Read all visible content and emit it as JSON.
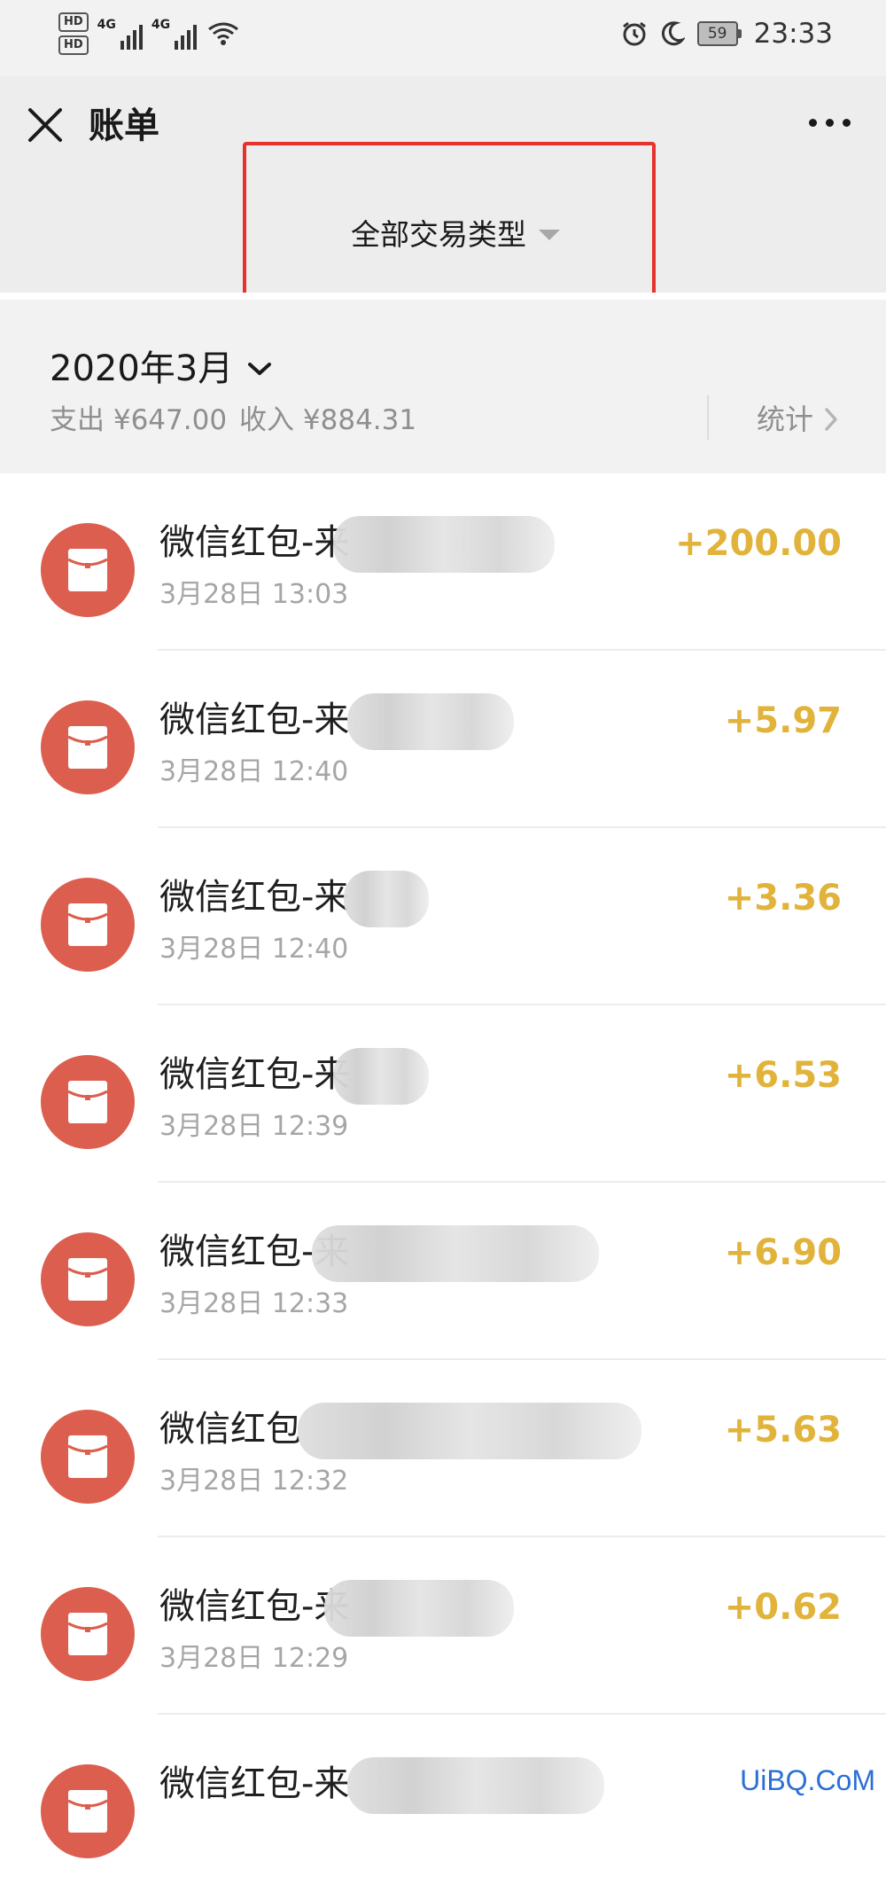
{
  "status_bar": {
    "hd1": "HD",
    "hd2": "HD",
    "sim1_tag": "4G",
    "sim2_tag": "4G",
    "battery": "59",
    "time": "23:33"
  },
  "nav": {
    "title": "账单",
    "close_icon": "close-icon",
    "more_icon": "more-icon"
  },
  "filter": {
    "label": "全部交易类型",
    "highlight_color": "#e5322d"
  },
  "month_header": {
    "month": "2020年3月",
    "expense": "支出 ¥647.00",
    "income": "收入 ¥884.31",
    "stats_label": "统计"
  },
  "transactions": [
    {
      "title": "微信红包-来",
      "time": "3月28日 13:03",
      "amount": "+200.00"
    },
    {
      "title": "微信红包-来",
      "time": "3月28日 12:40",
      "amount": "+5.97"
    },
    {
      "title": "微信红包-来",
      "time": "3月28日 12:40",
      "amount": "+3.36"
    },
    {
      "title": "微信红包-来",
      "time": "3月28日 12:39",
      "amount": "+6.53"
    },
    {
      "title": "微信红包-来",
      "time": "3月28日 12:33",
      "amount": "+6.90"
    },
    {
      "title": "微信红包",
      "time": "3月28日 12:32",
      "amount": "+5.63"
    },
    {
      "title": "微信红包-来",
      "time": "3月28日 12:29",
      "amount": "+0.62"
    },
    {
      "title": "微信红包-来",
      "time": "",
      "amount": ""
    }
  ],
  "colors": {
    "amount": "#e1b33a",
    "icon_bg": "#dc5e4e",
    "header_bg": "#ededed"
  },
  "watermark": "UiBQ.CoM"
}
